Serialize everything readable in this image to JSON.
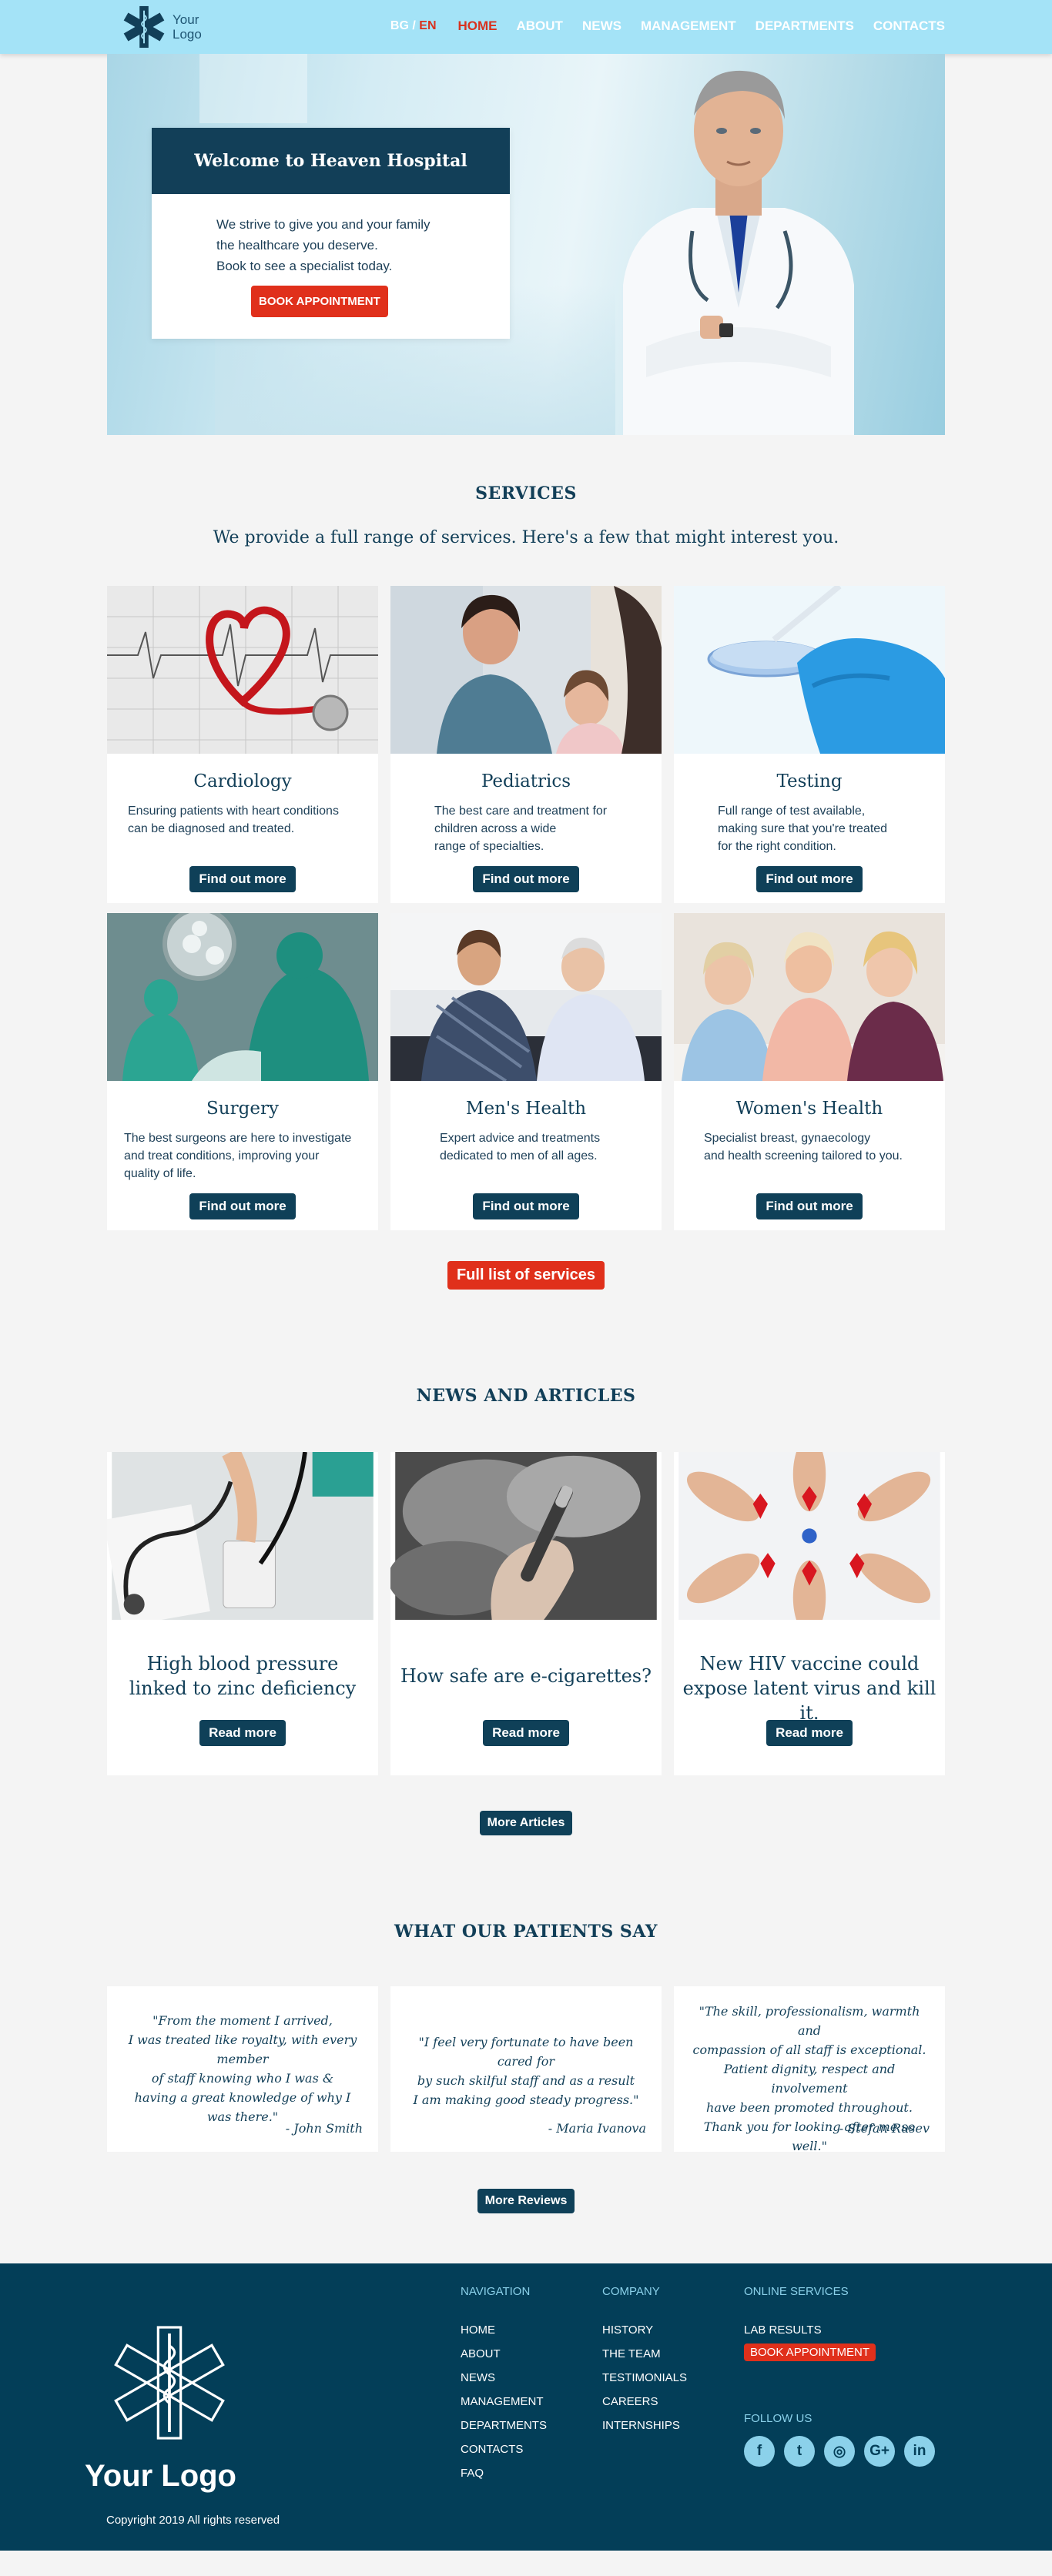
{
  "header": {
    "logo_text_line1": "Your",
    "logo_text_line2": "Logo",
    "lang_bg": "BG",
    "lang_sep": " / ",
    "lang_en": "EN",
    "nav": [
      "HOME",
      "ABOUT",
      "NEWS",
      "MANAGEMENT",
      "DEPARTMENTS",
      "CONTACTS"
    ]
  },
  "hero": {
    "title": "Welcome to Heaven Hospital",
    "line1": "We strive to give you and your family",
    "line2": "the healthcare you deserve.",
    "line3": "Book to see a specialist today.",
    "button": "BOOK APPOINTMENT"
  },
  "services": {
    "title": "SERVICES",
    "subtitle": "We provide a full range of services. Here's a few that might interest you.",
    "items": [
      {
        "title": "Cardiology",
        "desc": [
          "Ensuring patients with heart conditions",
          "can be diagnosed and treated."
        ],
        "button": "Find out more"
      },
      {
        "title": "Pediatrics",
        "desc": [
          "The best care and treatment for",
          "children across a wide",
          "range of specialties."
        ],
        "button": "Find out more"
      },
      {
        "title": "Testing",
        "desc": [
          "Full range of test available,",
          "making sure that you're treated",
          "for the right condition."
        ],
        "button": "Find out more"
      },
      {
        "title": "Surgery",
        "desc": [
          "The best surgeons are here to investigate",
          "and treat conditions, improving your",
          "quality of life."
        ],
        "button": "Find out more"
      },
      {
        "title": "Men's Health",
        "desc": [
          "Expert advice and treatments",
          "dedicated to men of all ages."
        ],
        "button": "Find out more"
      },
      {
        "title": "Women's Health",
        "desc": [
          "Specialist breast, gynaecology",
          "and health screening tailored to you."
        ],
        "button": "Find out more"
      }
    ],
    "full_list_button": "Full list of services"
  },
  "news": {
    "title": "NEWS AND ARTICLES",
    "items": [
      {
        "title_line1": "High blood pressure",
        "title_line2": "linked to zinc deficiency",
        "button": "Read more"
      },
      {
        "title_line1": "How safe are e-cigarettes?",
        "title_line2": "",
        "button": "Read more"
      },
      {
        "title_line1": "New HIV vaccine could",
        "title_line2": "expose latent virus and kill it.",
        "button": "Read more"
      }
    ],
    "more_button": "More Articles"
  },
  "reviews": {
    "title": "WHAT OUR PATIENTS SAY",
    "items": [
      {
        "lines": [
          "\"From the moment I arrived,",
          "I was treated like royalty, with every member",
          "of staff knowing who I was &",
          "having a great knowledge of why I was there.\""
        ],
        "author": "- John Smith"
      },
      {
        "lines": [
          "\"I feel very fortunate to have been cared for",
          "by such skilful staff and as a result",
          "I am making good steady progress.\""
        ],
        "author": "- Maria Ivanova"
      },
      {
        "lines": [
          "\"The skill, professionalism, warmth and",
          "compassion of all staff is exceptional.",
          "Patient dignity, respect and involvement",
          "have been promoted throughout.",
          "Thank you for looking after me so well.\""
        ],
        "author": "- Stefan Rusev"
      }
    ],
    "more_button": "More Reviews"
  },
  "footer": {
    "logo_text": "Your Logo",
    "copyright": "Copyright 2019 All rights reserved",
    "navigation_title": "NAVIGATION",
    "navigation": [
      "HOME",
      "ABOUT",
      "NEWS",
      "MANAGEMENT",
      "DEPARTMENTS",
      "CONTACTS",
      "FAQ"
    ],
    "company_title": "COMPANY",
    "company": [
      "HISTORY",
      "THE TEAM",
      "TESTIMONIALS",
      "CAREERS",
      "INTERNSHIPS"
    ],
    "online_title": "ONLINE SERVICES",
    "online": [
      "LAB RESULTS",
      "BOOK APPOINTMENT"
    ],
    "follow_title": "FOLLOW US",
    "social": [
      {
        "icon": "facebook-icon",
        "glyph": "f"
      },
      {
        "icon": "twitter-icon",
        "glyph": "t"
      },
      {
        "icon": "instagram-icon",
        "glyph": "◎"
      },
      {
        "icon": "google-plus-icon",
        "glyph": "G+"
      },
      {
        "icon": "linkedin-icon",
        "glyph": "in"
      }
    ]
  },
  "colors": {
    "accent_red": "#e0301b",
    "dark_teal": "#0f4058",
    "header_blue": "#a4e3f7",
    "footer_bg": "#033e58"
  }
}
